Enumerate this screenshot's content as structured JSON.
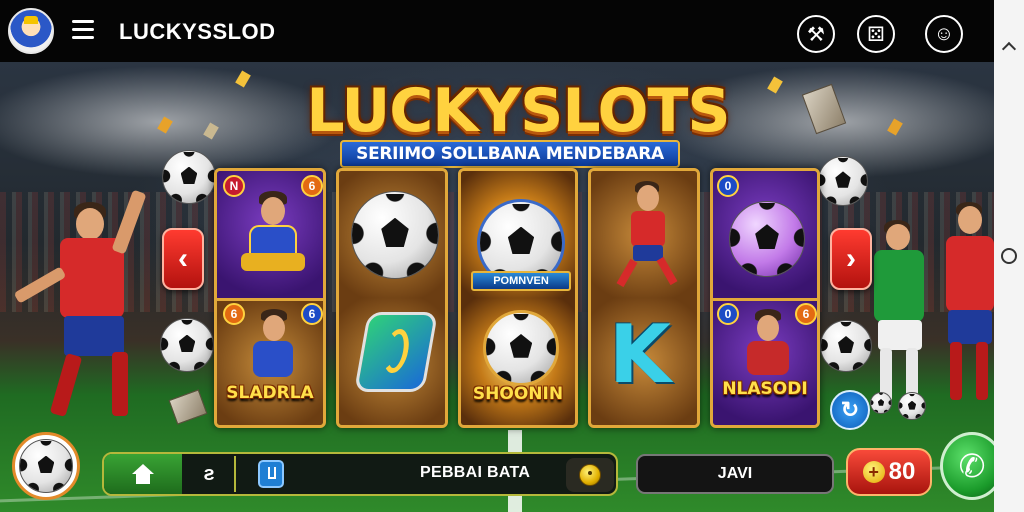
{
  "header": {
    "title": "LUCKYSSLOD",
    "icons": [
      "avatar",
      "hamburger-menu-icon",
      "pick-tool-icon",
      "dice-icon",
      "support-icon"
    ]
  },
  "game": {
    "logo": "LUCKYSLOTS",
    "subtitle": "SERIIMO SOLLBANA MENDEBARA",
    "colors": {
      "logo_gold": "#ffd23f",
      "reel_border": "#e1a83a",
      "accent_red": "#ff3b30",
      "accent_green": "#39a334"
    }
  },
  "reels": {
    "reel1": {
      "top_badge_left": "N",
      "top_badge_right": "6",
      "bottom_badge_left": "6",
      "bottom_badge_right": "6",
      "bottom_label": "SLADRLA"
    },
    "reel3": {
      "emblem_label": "POMNVEN",
      "bottom_label": "SHOONIN"
    },
    "reel5": {
      "top_badge": "0",
      "bottom_badge_left": "0",
      "bottom_badge_right": "6",
      "bottom_label": "NLASODI"
    }
  },
  "nav": {
    "prev": "‹",
    "next": "›"
  },
  "bottom_bar": {
    "home": "home-icon",
    "mid_label": "ƨ",
    "bet_label": "PEBBAI BATA",
    "jav_label": "JAVI",
    "credit_value": "80",
    "credit_prefix": "+",
    "refresh_icon": "refresh-icon",
    "phone_icon": "phone-icon"
  }
}
